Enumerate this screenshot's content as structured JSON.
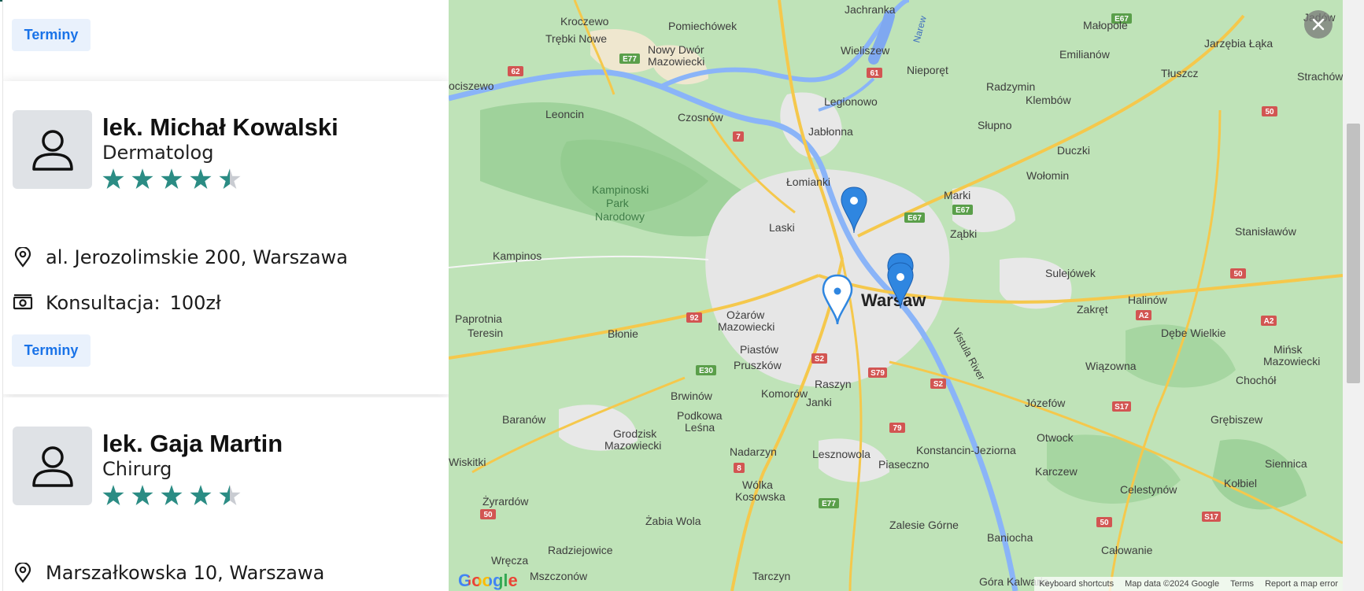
{
  "top_card": {
    "terminy_label": "Terminy"
  },
  "doctors": [
    {
      "name": "lek. Michał Kowalski",
      "specialty": "Dermatolog",
      "rating": 4.5,
      "address": "al. Jerozolimskie 200, Warszawa",
      "price_label": "Konsultacja:",
      "price_value": "100zł",
      "terminy_label": "Terminy"
    },
    {
      "name": "lek. Gaja Martin",
      "specialty": "Chirurg",
      "rating": 4.5,
      "address": "Marszałkowska 10, Warszawa"
    }
  ],
  "map": {
    "places": {
      "kroczewo": "Kroczewo",
      "pomiechowek": "Pomiechówek",
      "jachranka": "Jachranka",
      "malopole": "Małopole",
      "jarzebia": "Jarzębia Łąka",
      "trebki": "Trębki Nowe",
      "nowydwor": "Nowy Dwór",
      "mazowiecki": "Mazowiecki",
      "wieliszew": "Wieliszew",
      "emilianow": "Emilianów",
      "nieporet": "Nieporęt",
      "tluszcz": "Tłuszcz",
      "strachow": "Strachów",
      "ociszewo": "ociszewo",
      "radzymin": "Radzymin",
      "leoncin": "Leoncin",
      "czosnow": "Czosnów",
      "legionowo": "Legionowo",
      "klembow": "Klembów",
      "jablonna": "Jabłonna",
      "slupno": "Słupno",
      "duczki": "Duczki",
      "lomianki": "Łomianki",
      "wolomin": "Wołomin",
      "kampinoski1": "Kampinoski",
      "kampinoski2": "Park",
      "kampinoski3": "Narodowy",
      "marki": "Marki",
      "laski": "Laski",
      "zabki": "Ząbki",
      "stanislawow": "Stanisławów",
      "kampinos": "Kampinos",
      "sulejowek": "Sulejówek",
      "warsaw": "Warsaw",
      "paprotnia": "Paprotnia",
      "teresin": "Teresin",
      "ozarow1": "Ożarów",
      "ozarow2": "Mazowiecki",
      "halinow": "Halinów",
      "zakret": "Zakręt",
      "debe": "Dębe Wielkie",
      "minsk1": "Mińsk",
      "minsk2": "Mazowiecki",
      "blonie": "Błonie",
      "piastow": "Piastów",
      "pruszkow": "Pruszków",
      "vistula": "Vistula River",
      "wiazowna": "Wiązowna",
      "raszyn": "Raszyn",
      "brwinow": "Brwinów",
      "komorow": "Komorów",
      "chocholl": "Chochół",
      "janki": "Janki",
      "jozefow": "Józefów",
      "baranow": "Baranów",
      "podkowa1": "Podkowa",
      "podkowa2": "Leśna",
      "grebiszew": "Grębiszew",
      "grodzisk1": "Grodzisk",
      "grodzisk2": "Mazowiecki",
      "otwock": "Otwock",
      "wiskitki": "Wiskitki",
      "nadarzyn": "Nadarzyn",
      "lesznowola": "Lesznowola",
      "konstancin": "Konstancin-Jeziorna",
      "siennica": "Siennica",
      "piaseczno": "Piaseczno",
      "karczew": "Karczew",
      "celestynow": "Celestynów",
      "wolka1": "Wólka",
      "wolka2": "Kosowska",
      "zyrardow": "Żyrardów",
      "kolbiel": "Kołbiel",
      "zabiawola": "Żabia Wola",
      "zalesie": "Zalesie Górne",
      "baniocha": "Baniocha",
      "radziejowice": "Radziejowice",
      "wrecza": "Wręcza",
      "calowanie": "Całowanie",
      "mszczonow": "Mszczonów",
      "tarczyn": "Tarczyn",
      "gora": "Góra Kalwaria",
      "jadow": "Jadów",
      "narew": "Narew"
    },
    "road_badges": [
      "62",
      "E77",
      "61",
      "E67",
      "7",
      "E67",
      "E67",
      "50",
      "50",
      "92",
      "S2",
      "A2",
      "A2",
      "E30",
      "S79",
      "S2",
      "S17",
      "79",
      "8",
      "E77",
      "50",
      "S17",
      "50"
    ],
    "attribution": {
      "shortcuts": "Keyboard shortcuts",
      "data": "Map data ©2024 Google",
      "terms": "Terms",
      "report": "Report a map error"
    },
    "logo": "Google"
  },
  "colors": {
    "accent": "#1a73e8",
    "star": "#2b8c84",
    "star_empty": "#c9ccd2",
    "pin": "#2f86e0"
  }
}
